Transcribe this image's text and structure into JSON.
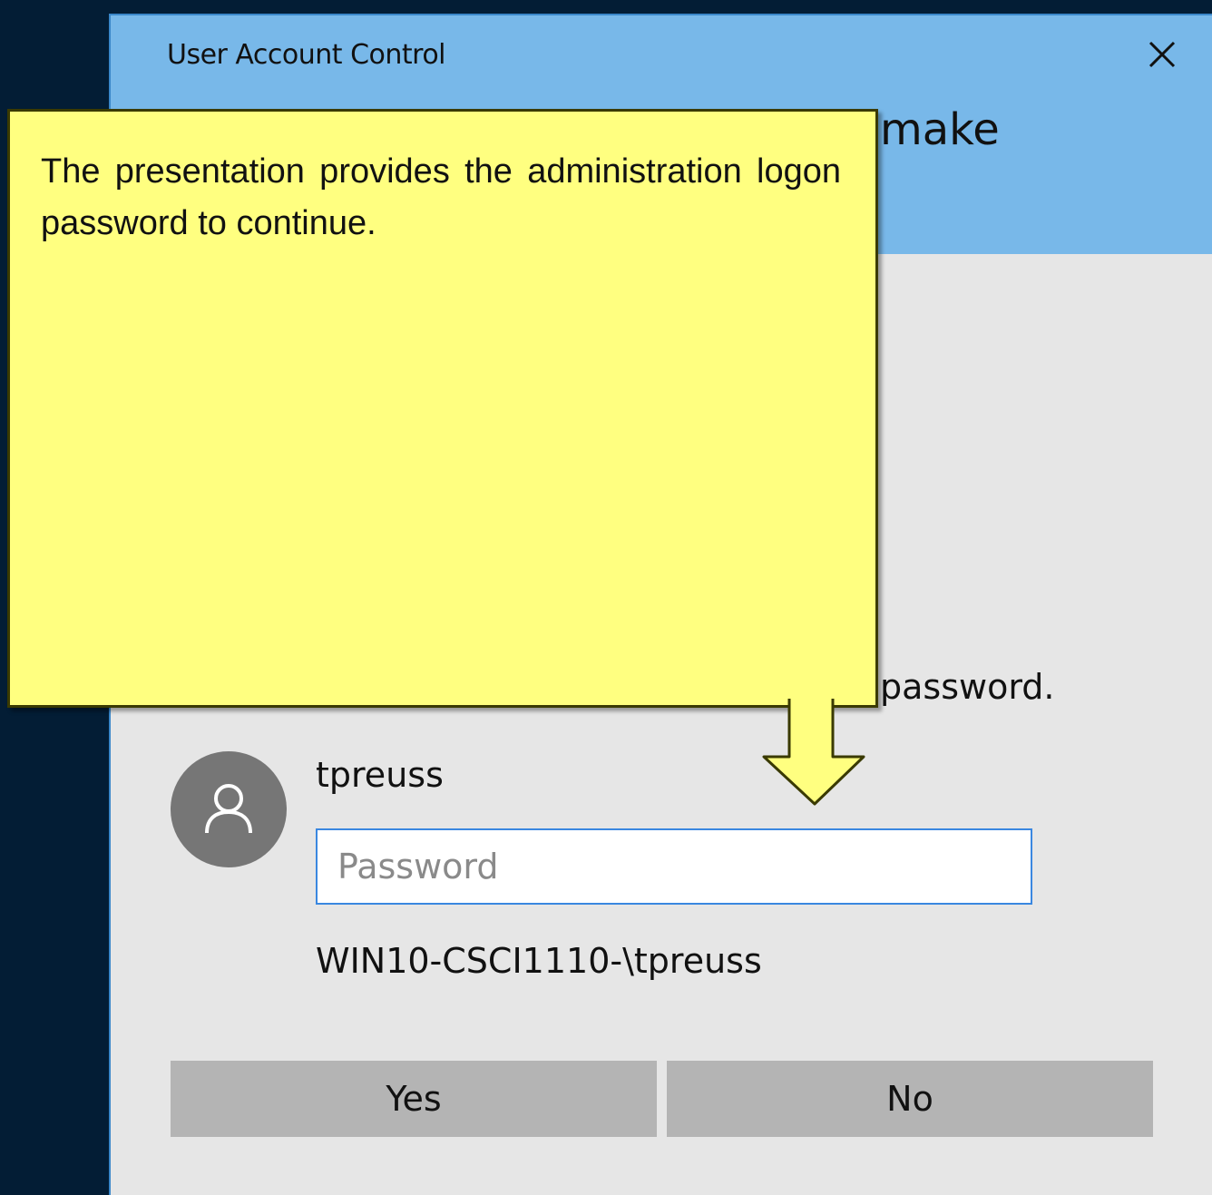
{
  "dialog": {
    "title": "User Account Control",
    "header_visible_fragment": "make",
    "instruction_visible_fragment": "password.",
    "username": "tpreuss",
    "password_placeholder": "Password",
    "password_value": "",
    "domain_user": "WIN10-CSCI1110-\\tpreuss",
    "yes_label": "Yes",
    "no_label": "No"
  },
  "callout": {
    "text": "The presentation provides the administration logon password to continue."
  },
  "colors": {
    "header_bg": "#78b8e9",
    "body_bg": "#e6e6e6",
    "button_bg": "#b4b4b4",
    "callout_bg": "#ffff80",
    "input_border": "#3a87e0",
    "desktop_bg": "#031d35"
  },
  "icons": {
    "close": "close-icon",
    "avatar": "user-avatar-icon",
    "arrow": "down-arrow-icon"
  }
}
